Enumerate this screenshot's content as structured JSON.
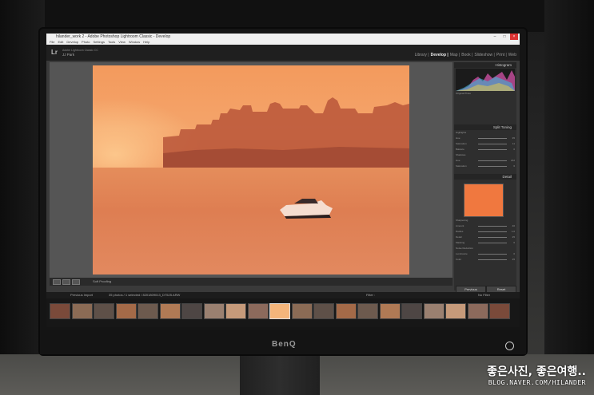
{
  "window": {
    "title": "hilander_work 2 - Adobe Photoshop Lightroom Classic - Develop",
    "menu": [
      "File",
      "Edit",
      "Develop",
      "Photo",
      "Settings",
      "Tools",
      "View",
      "Window",
      "Help"
    ]
  },
  "identity": {
    "logo": "Lr",
    "line1": "Adobe Lightroom Classic CC",
    "line2": "JJ Park"
  },
  "modules": [
    "Library",
    "Develop",
    "Map",
    "Book",
    "Slideshow",
    "Print",
    "Web"
  ],
  "active_module": "Develop",
  "panels": {
    "histogram": "Histogram",
    "split_toning": "Split Toning",
    "detail": "Detail",
    "original_photo": "Original Photo",
    "split_rows": [
      {
        "label": "Highlights",
        "value": ""
      },
      {
        "label": "Hue",
        "value": "35"
      },
      {
        "label": "Saturation",
        "value": "11"
      },
      {
        "label": "Balance",
        "value": "0"
      },
      {
        "label": "Shadows",
        "value": ""
      },
      {
        "label": "Hue",
        "value": "212"
      },
      {
        "label": "Saturation",
        "value": "6"
      }
    ],
    "detail_rows": [
      {
        "label": "Sharpening",
        "value": ""
      },
      {
        "label": "Amount",
        "value": "40"
      },
      {
        "label": "Radius",
        "value": "1.0"
      },
      {
        "label": "Detail",
        "value": "25"
      },
      {
        "label": "Masking",
        "value": "0"
      },
      {
        "label": "Noise Reduction",
        "value": ""
      },
      {
        "label": "Luminance",
        "value": "0"
      },
      {
        "label": "Color",
        "value": "25"
      }
    ]
  },
  "buttons": {
    "previous": "Previous",
    "reset": "Reset"
  },
  "toolbar": {
    "soft_proofing": "Soft Proofing"
  },
  "filmstrip": {
    "source": "Previous Import",
    "count": "35 photos / 1 selected / 8201809013_DT525.ARW",
    "filter_label": "Filter :",
    "no_filter": "No Filter",
    "thumb_count": 21,
    "selected_index": 10
  },
  "monitor": {
    "brand": "BenQ"
  },
  "watermark": {
    "korean": "좋은사진, 좋은여행..",
    "blog": "BLOG.NAVER.COM/HILANDER"
  },
  "colors": {
    "accent_orange": "#f0783f",
    "lr_dark": "#1f1f1f"
  }
}
